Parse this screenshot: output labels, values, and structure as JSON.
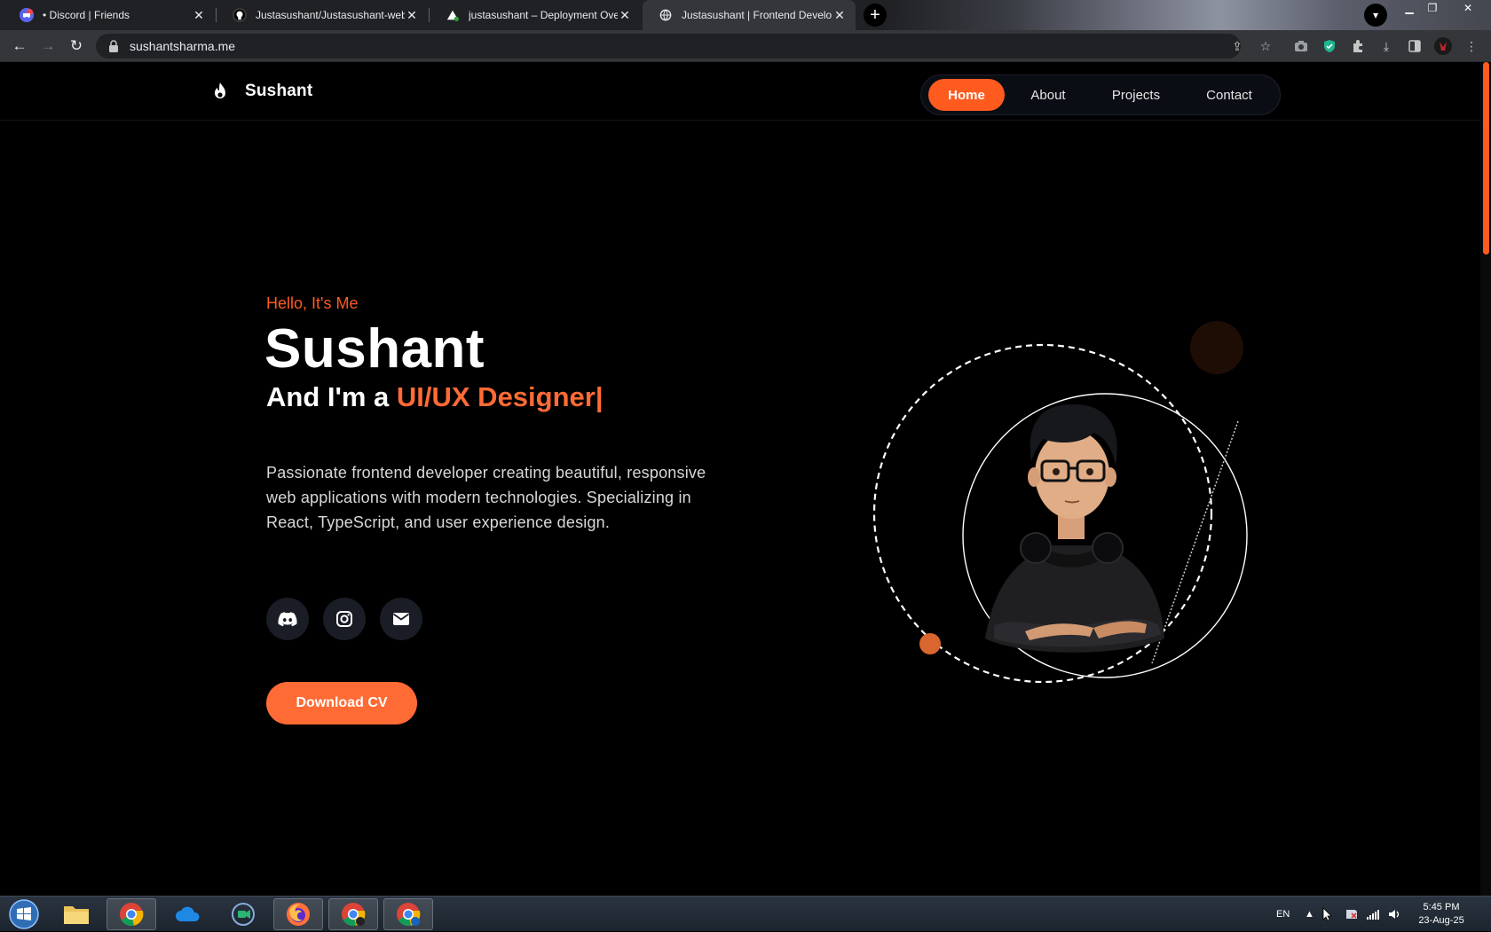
{
  "browser": {
    "tabs": [
      {
        "title": "• Discord | Friends",
        "icon": "discord-favicon",
        "active": false
      },
      {
        "title": "Justasushant/Justasushant-web: ",
        "icon": "github-favicon",
        "active": false
      },
      {
        "title": "justasushant – Deployment Overv",
        "icon": "vercel-favicon",
        "active": false
      },
      {
        "title": "Justasushant | Frontend Develope",
        "icon": "globe-favicon",
        "active": true
      }
    ],
    "url": "sushantsharma.me"
  },
  "site": {
    "brand": "Sushant",
    "nav": [
      "Home",
      "About",
      "Projects",
      "Contact"
    ],
    "active_nav": "Home",
    "hero": {
      "greeting": "Hello, It's Me",
      "name": "Sushant",
      "role_prefix": "And I'm a ",
      "role_highlight": "UI/UX Designer|",
      "description": "Passionate frontend developer creating beautiful, responsive web applications with modern technologies. Specializing in React, TypeScript, and user experience design.",
      "socials": [
        "discord-icon",
        "instagram-icon",
        "mail-icon"
      ],
      "cta": "Download CV"
    },
    "colors": {
      "accent": "#ff5b1f",
      "highlight": "#ff6b35",
      "background": "#000000"
    }
  },
  "taskbar": {
    "apps": [
      "file-explorer",
      "chrome",
      "onedrive",
      "meet",
      "firefox",
      "chrome-profile-1",
      "chrome-profile-2"
    ],
    "language": "EN",
    "time": "5:45 PM",
    "date": "23-Aug-25"
  }
}
